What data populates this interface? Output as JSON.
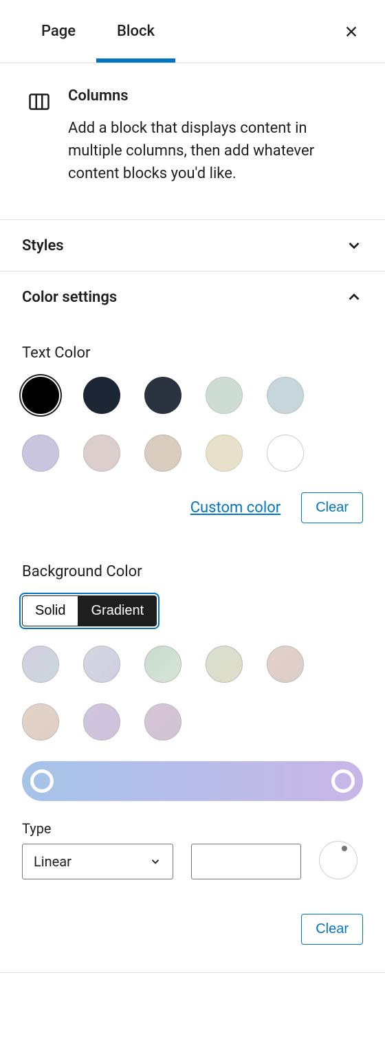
{
  "tabs": {
    "page": "Page",
    "block": "Block"
  },
  "block_info": {
    "title": "Columns",
    "description": "Add a block that displays content in multiple columns, then add whatever content blocks you'd like."
  },
  "panels": {
    "styles": {
      "title": "Styles"
    },
    "color_settings": {
      "title": "Color settings"
    }
  },
  "text_color": {
    "label": "Text Color",
    "swatches": [
      {
        "color": "#000000",
        "selected": true
      },
      {
        "color": "#1d2634"
      },
      {
        "color": "#2b3240"
      },
      {
        "color": "#cdddd3"
      },
      {
        "color": "#c6d6db"
      },
      {
        "color": "#cac5de"
      },
      {
        "color": "#dccecd"
      },
      {
        "color": "#d7ccbd"
      },
      {
        "color": "#e7e1cb"
      },
      {
        "color": "#ffffff"
      }
    ],
    "custom_link": "Custom color",
    "clear_btn": "Clear"
  },
  "background_color": {
    "label": "Background Color",
    "toggle": {
      "solid": "Solid",
      "gradient": "Gradient"
    },
    "swatches": [
      {
        "gradient": "linear-gradient(135deg,#d6cce0,#c9d9dd)"
      },
      {
        "gradient": "linear-gradient(135deg,#d4d8e0,#cfcde3)"
      },
      {
        "gradient": "linear-gradient(135deg,#c9ddd0,#d6e3d4)"
      },
      {
        "gradient": "linear-gradient(135deg,#d9dfce,#dfdccb)"
      },
      {
        "gradient": "linear-gradient(135deg,#e0d1c9,#decdc8)"
      },
      {
        "gradient": "linear-gradient(135deg,#e2d3c8,#e0cfc3)"
      },
      {
        "gradient": "linear-gradient(135deg,#d2c5de,#cdc1dc)"
      },
      {
        "gradient": "linear-gradient(135deg,#d5c5d6,#d2c3d4)"
      }
    ],
    "type_label": "Type",
    "type_value": "Linear",
    "angle_value": "",
    "clear_btn": "Clear"
  }
}
